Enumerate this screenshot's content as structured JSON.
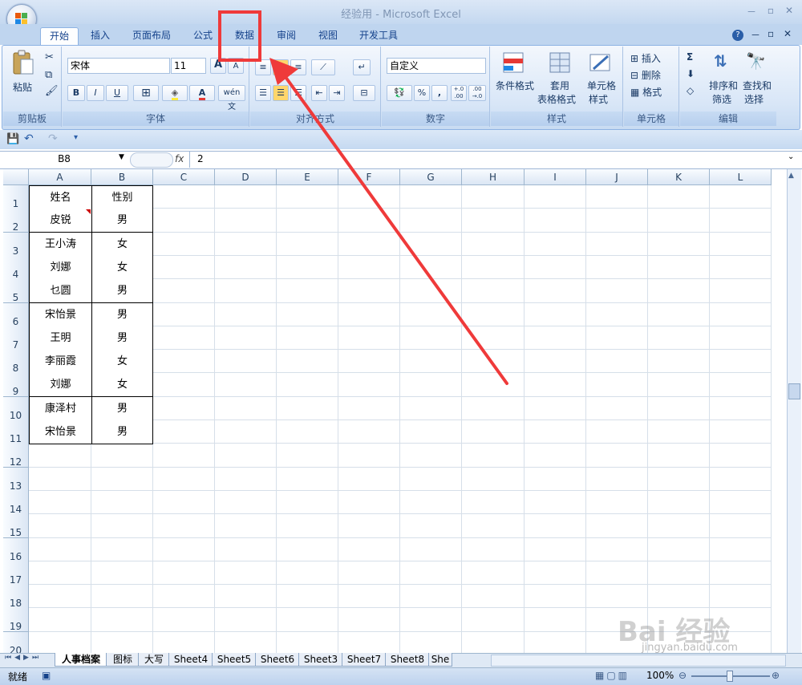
{
  "window": {
    "title": "经验用 - Microsoft Excel",
    "controls": [
      "－",
      "▫",
      "✕"
    ]
  },
  "ribbon_tabs": [
    "开始",
    "插入",
    "页面布局",
    "公式",
    "数据",
    "审阅",
    "视图",
    "开发工具"
  ],
  "ribbon_right_icons": [
    "?",
    "－",
    "▫",
    "✕"
  ],
  "groups": {
    "clipboard": {
      "label": "剪贴板",
      "paste": "粘贴"
    },
    "font": {
      "label": "字体",
      "font_name": "宋体",
      "font_size": "11",
      "grow": "A",
      "shrink": "A",
      "bold": "B",
      "italic": "I",
      "underline": "U",
      "phonetic": "wén 文"
    },
    "alignment": {
      "label": "对齐方式"
    },
    "number": {
      "label": "数字",
      "format": "自定义",
      "percent": "%",
      "comma": ",",
      "inc_dec": "+.0 .00",
      "dec_dec": ".00 →.0"
    },
    "styles": {
      "label": "样式",
      "cond_format": "条件格式",
      "table_format_1": "套用",
      "table_format_2": "表格格式",
      "cell_style_1": "单元格",
      "cell_style_2": "样式"
    },
    "cells": {
      "label": "单元格",
      "insert": "插入",
      "delete": "删除",
      "format": "格式"
    },
    "editing": {
      "label": "编辑",
      "sum": "Σ",
      "sort_1": "排序和",
      "sort_2": "筛选",
      "find_1": "查找和",
      "find_2": "选择"
    }
  },
  "formula_bar": {
    "name_box": "B8",
    "fx": "fx",
    "value": "2"
  },
  "columns": [
    "A",
    "B",
    "C",
    "D",
    "E",
    "F",
    "G",
    "H",
    "I",
    "J",
    "K",
    "L"
  ],
  "rows": [
    "1",
    "2",
    "3",
    "4",
    "5",
    "6",
    "7",
    "8",
    "9",
    "10",
    "11",
    "12",
    "13",
    "14",
    "15",
    "16",
    "17",
    "18",
    "19",
    "20"
  ],
  "table": [
    [
      "姓名",
      "性别"
    ],
    [
      "皮锐",
      "男"
    ],
    [
      "王小涛",
      "女"
    ],
    [
      "刘娜",
      "女"
    ],
    [
      "乜圆",
      "男"
    ],
    [
      "宋怡景",
      "男"
    ],
    [
      "王明",
      "男"
    ],
    [
      "李丽霞",
      "女"
    ],
    [
      "刘娜",
      "女"
    ],
    [
      "康泽村",
      "男"
    ],
    [
      "宋怡景",
      "男"
    ]
  ],
  "sheet_tabs": [
    "人事档案",
    "图标",
    "大写",
    "Sheet4",
    "Sheet5",
    "Sheet6",
    "Sheet3",
    "Sheet7",
    "Sheet8",
    "She"
  ],
  "status": {
    "ready": "就绪",
    "zoom": "100%"
  },
  "watermark": {
    "brand": "Bai 经验",
    "url": "jingyan.baidu.com"
  },
  "annotation_color": "#ef3a3a"
}
